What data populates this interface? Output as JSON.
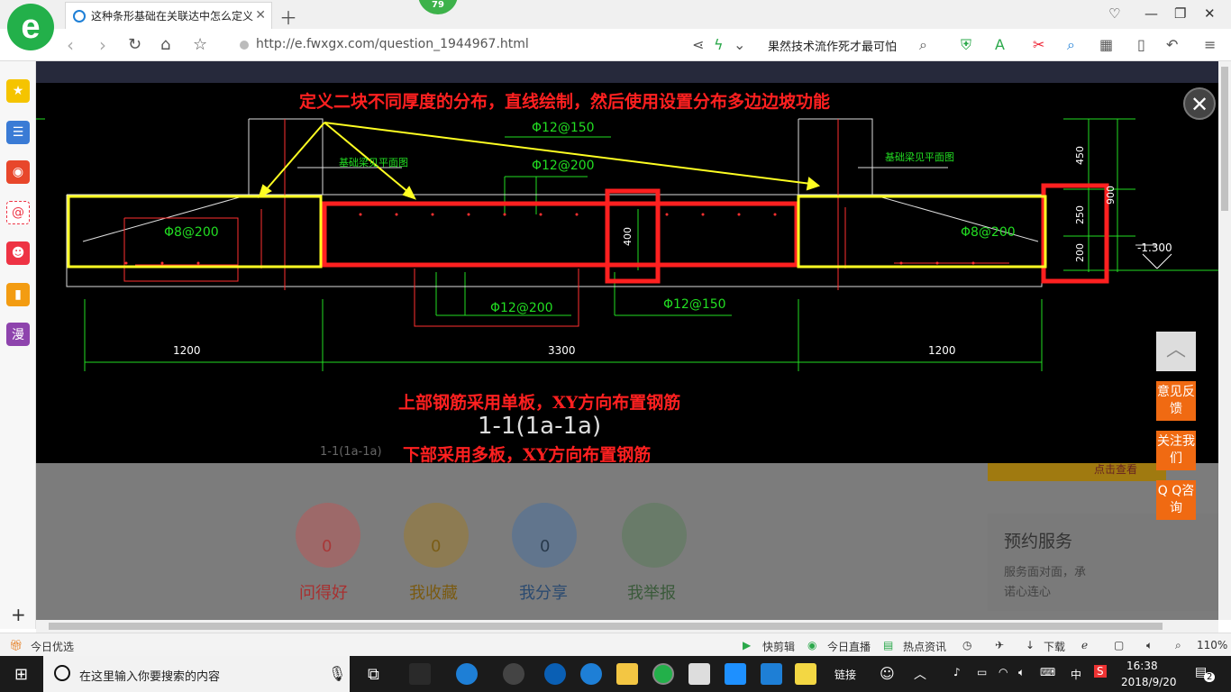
{
  "browser": {
    "logo_letter": "e",
    "tab_title": "这种条形基础在关联达中怎么定义",
    "badge": "79",
    "url": "http://e.fwxgx.com/question_1944967.html",
    "search_hint": "果然技术流作死才最可怕"
  },
  "sidebar": {
    "items": [
      "favorites-icon",
      "list-icon",
      "weibo-icon",
      "mail-icon",
      "game-icon",
      "book-icon",
      "manga-icon"
    ],
    "manga_label": "漫"
  },
  "cad": {
    "annotation_top": "定义二块不同厚度的分布，直线绘制，然后使用设置分布多边边坡功能",
    "annotation_upper": "上部钢筋采用单板，XY方向布置钢筋",
    "annotation_lower": "下部采用多板，XY方向布置钢筋",
    "section_title": "1-1(1a-1a)",
    "section_title_small": "1-1(1a-1a)",
    "rebar_labels": {
      "top_150": "Φ12@150",
      "top_200": "Φ12@200",
      "left_8": "Φ8@200",
      "right_8": "Φ8@200",
      "bottom_200": "Φ12@200",
      "bottom_150": "Φ12@150"
    },
    "beam_note_left": "基础梁见平面图",
    "beam_note_right": "基础梁见平面图",
    "dims": {
      "left": "1200",
      "middle": "3300",
      "right": "1200",
      "d450": "450",
      "d250": "250",
      "d200": "200",
      "d900": "900",
      "d400": "400",
      "elev": "-1.300"
    }
  },
  "page_under": {
    "actions": [
      {
        "label": "问得好",
        "count": "0"
      },
      {
        "label": "我收藏",
        "count": "0"
      },
      {
        "label": "我分享",
        "count": "0"
      },
      {
        "label": "我举报",
        "count": ""
      }
    ],
    "promo_text": "点击查看",
    "service_title": "预约服务",
    "service_desc_1": "服务面对面，承",
    "service_desc_2": "诺心连心"
  },
  "floating": {
    "feedback": "意见反馈",
    "follow": "关注我们",
    "qq": "Q Q咨询"
  },
  "statusbar": {
    "left": "今日优选",
    "quick_cut": "快剪辑",
    "live": "今日直播",
    "news": "热点资讯",
    "download": "下载",
    "zoom": "110%"
  },
  "taskbar": {
    "search_placeholder": "在这里输入你要搜索的内容",
    "link": "链接",
    "ime": "中",
    "time": "16:38",
    "date": "2018/9/20",
    "notif": "2"
  },
  "colors": {
    "annotation_red": "#ff2020",
    "cad_green": "#22dd22",
    "cad_yellow": "#ffff22",
    "accent_orange": "#f06a12"
  }
}
